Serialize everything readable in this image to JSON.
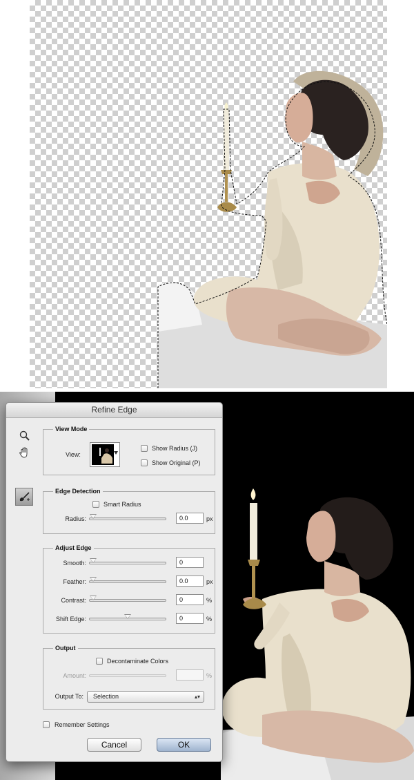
{
  "dialog": {
    "title": "Refine Edge",
    "tools": {
      "zoom_icon": "zoom-icon",
      "hand_icon": "hand-icon",
      "brush_icon": "refine-radius-brush-icon"
    },
    "view_mode": {
      "heading": "View Mode",
      "view_label": "View:",
      "show_radius": "Show Radius (J)",
      "show_original": "Show Original (P)"
    },
    "edge_detection": {
      "heading": "Edge Detection",
      "smart_radius": "Smart Radius",
      "radius_label": "Radius:",
      "radius_value": "0.0",
      "radius_unit": "px",
      "radius_level": 0
    },
    "adjust_edge": {
      "heading": "Adjust Edge",
      "smooth_label": "Smooth:",
      "smooth_value": "0",
      "smooth_level": 0,
      "feather_label": "Feather:",
      "feather_value": "0.0",
      "feather_unit": "px",
      "feather_level": 0,
      "contrast_label": "Contrast:",
      "contrast_value": "0",
      "contrast_unit": "%",
      "contrast_level": 0,
      "shift_label": "Shift Edge:",
      "shift_value": "0",
      "shift_unit": "%",
      "shift_level": 0.5
    },
    "output": {
      "heading": "Output",
      "decontaminate": "Decontaminate Colors",
      "amount_label": "Amount:",
      "amount_value": "",
      "amount_unit": "%",
      "output_to_label": "Output To:",
      "output_to_value": "Selection"
    },
    "remember": "Remember Settings",
    "cancel": "Cancel",
    "ok": "OK"
  },
  "colors": {
    "canvas_background": "#000000",
    "dialog_background": "#ececec",
    "ok_button": "#9fb4cf"
  }
}
